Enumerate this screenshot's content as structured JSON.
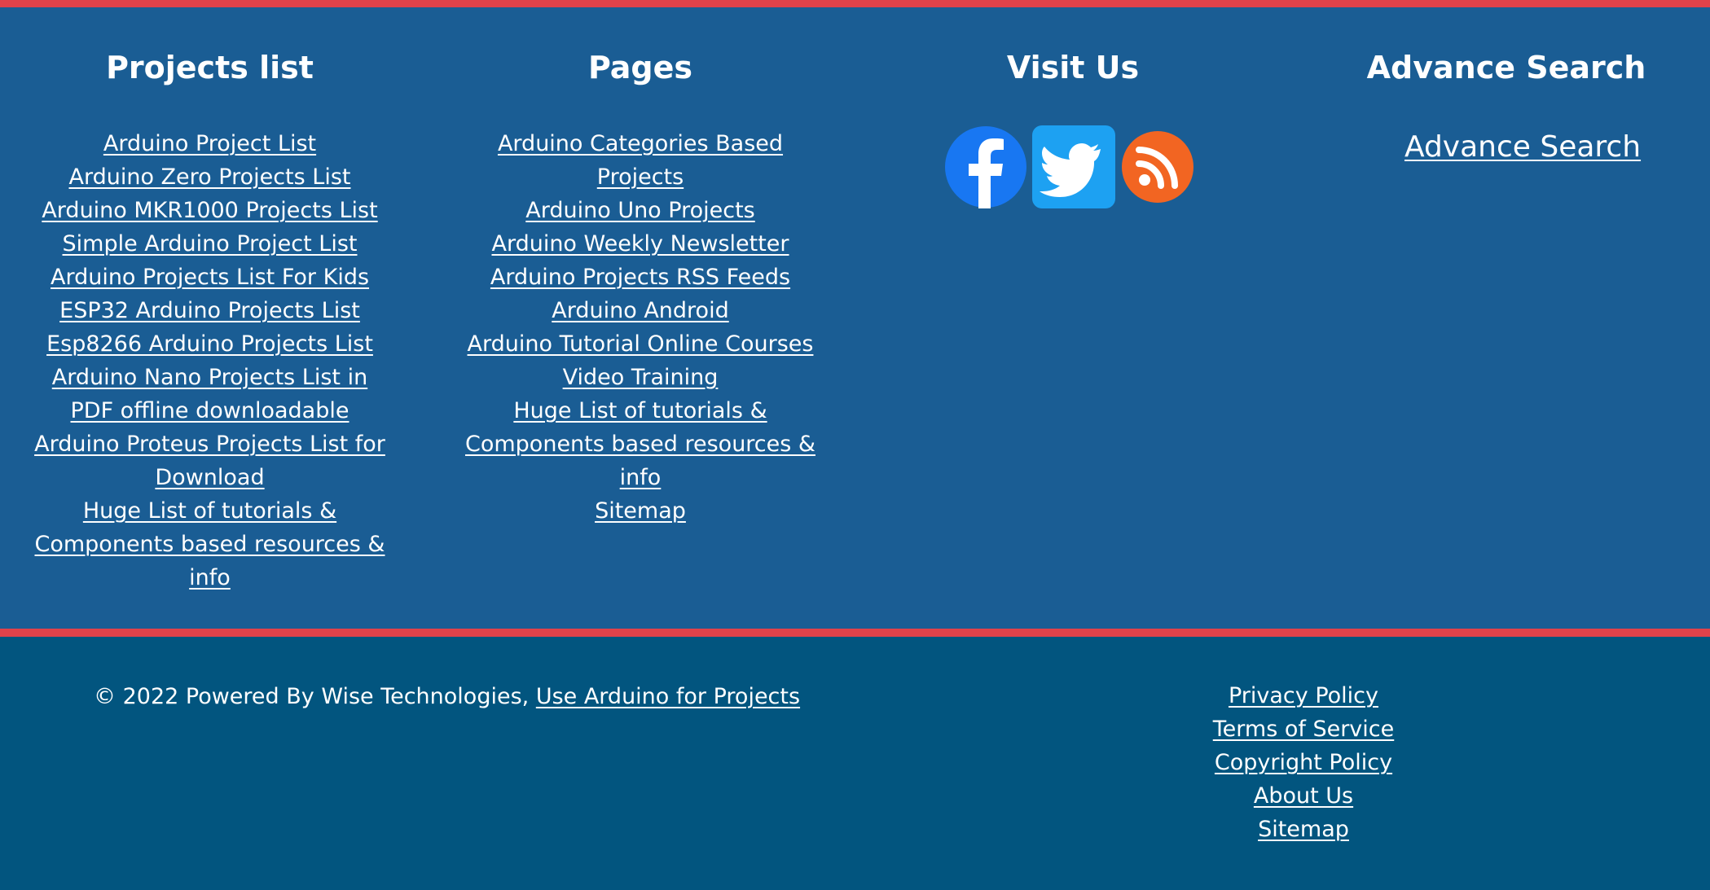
{
  "projects": {
    "title": "Projects list",
    "links": [
      "Arduino Project List",
      "Arduino Zero Projects List",
      "Arduino MKR1000 Projects List",
      "Simple Arduino Project List",
      "Arduino Projects List For Kids",
      "ESP32 Arduino Projects List",
      "Esp8266 Arduino Projects List",
      "Arduino Nano Projects List in PDF offline downloadable",
      "Arduino Proteus Projects List for Download",
      "Huge List of tutorials & Components based resources & info"
    ]
  },
  "pages": {
    "title": "Pages",
    "links": [
      "Arduino Categories Based Projects",
      "Arduino Uno Projects",
      "Arduino Weekly Newsletter",
      "Arduino Projects RSS Feeds",
      "Arduino Android",
      "Arduino Tutorial Online Courses",
      "Video Training",
      "Huge List of tutorials & Components based resources & info",
      "Sitemap"
    ]
  },
  "visit": {
    "title": "Visit Us",
    "icons": [
      "facebook-icon",
      "twitter-icon",
      "rss-icon"
    ],
    "colors": {
      "facebook": "#1877f2",
      "twitter": "#1da1f2",
      "rss": "#f26522"
    }
  },
  "search": {
    "title": "Advance Search",
    "link": "Advance Search"
  },
  "footer": {
    "copyright_text": "© 2022 Powered By Wise Technologies, ",
    "copyright_link": "Use Arduino for Projects",
    "policy_links": [
      "Privacy Policy",
      "Terms of Service",
      "Copyright Policy",
      "About Us",
      "Sitemap"
    ]
  },
  "theme": {
    "top_bg": "#1a5d94",
    "bottom_bg": "#02557f",
    "accent": "#e0424a"
  }
}
